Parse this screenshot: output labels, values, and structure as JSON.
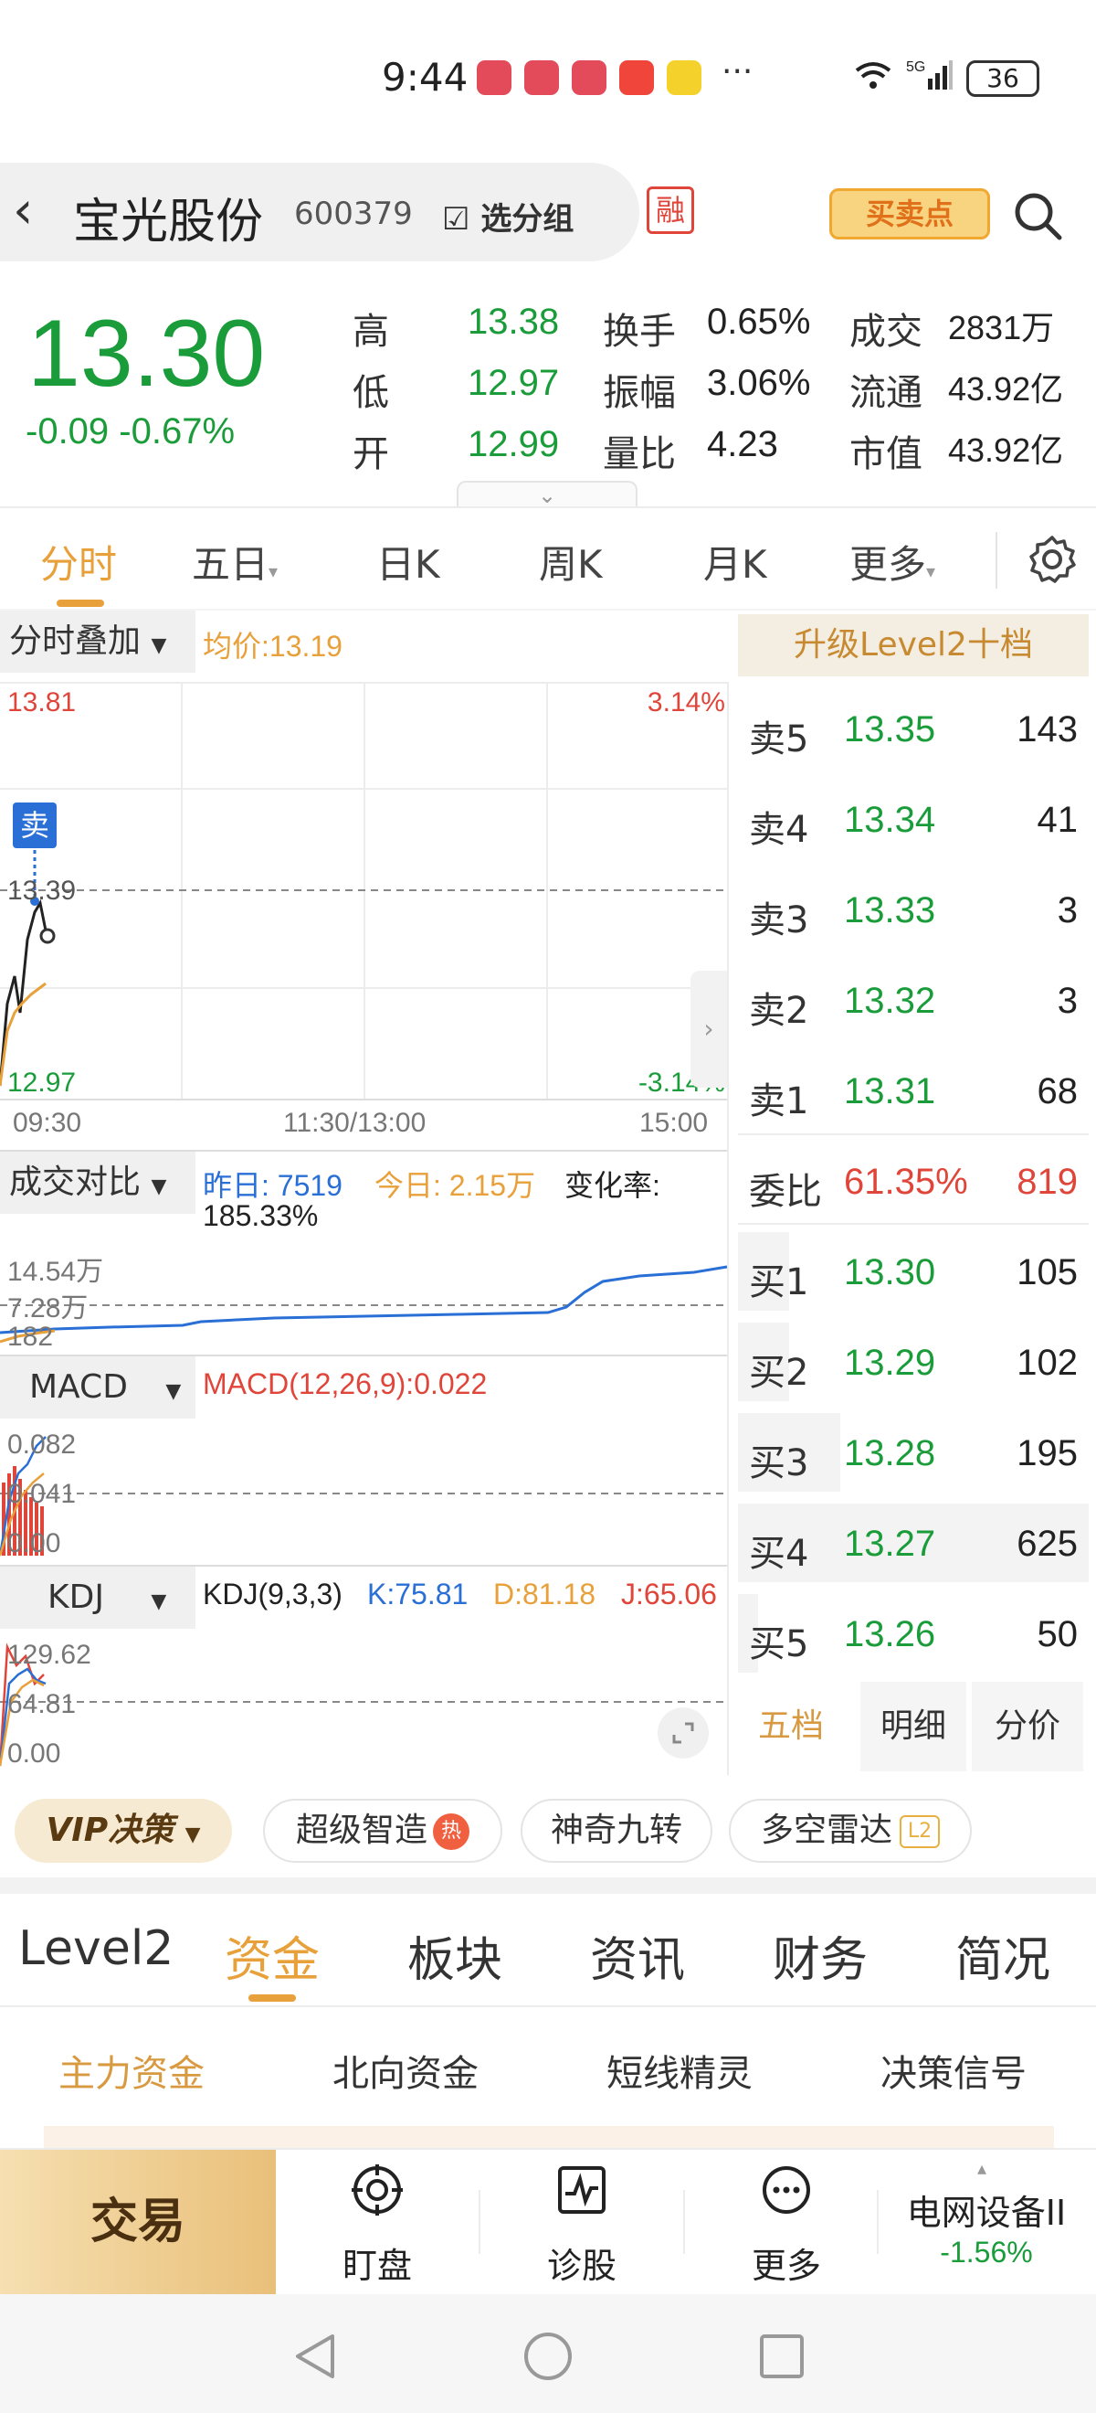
{
  "status_bar": {
    "time": "9:44",
    "dots": "···",
    "network": "5G",
    "wifi_num": "6",
    "battery": "36"
  },
  "header": {
    "name": "宝光股份",
    "code": "600379",
    "group_label": "选分组",
    "rong_label": "融",
    "buy_sell_label": "买卖点"
  },
  "quote": {
    "price": "13.30",
    "change": "-0.09",
    "change_pct": "-0.67%",
    "rows": [
      {
        "l1": "高",
        "v1": "13.38",
        "l2": "换手",
        "v2": "0.65%",
        "l3": "成交",
        "v3": "2831万"
      },
      {
        "l1": "低",
        "v1": "12.97",
        "l2": "振幅",
        "v2": "3.06%",
        "l3": "流通",
        "v3": "43.92亿"
      },
      {
        "l1": "开",
        "v1": "12.99",
        "l2": "量比",
        "v2": "4.23",
        "l3": "市值",
        "v3": "43.92亿"
      }
    ]
  },
  "time_tabs": [
    "分时",
    "五日",
    "日K",
    "周K",
    "月K",
    "更多"
  ],
  "chart": {
    "overlay_label": "分时叠加",
    "avg_price": "均价:13.19",
    "y_top": "13.81",
    "y_mark": "13.39",
    "y_bottom": "12.97",
    "pct_top": "3.14%",
    "pct_bottom": "-3.14%",
    "sell_tag": "卖",
    "x_labels": [
      "09:30",
      "11:30/13:00",
      "15:00"
    ],
    "volume": {
      "label": "成交对比",
      "yesterday": "昨日: 7519",
      "today": "今日: 2.15万",
      "change_rate_label": "变化率:",
      "change_rate": "185.33%",
      "y1": "14.54万",
      "y2": "7.28万",
      "y3": "182"
    },
    "macd": {
      "label": "MACD",
      "value": "MACD(12,26,9):0.022",
      "y1": "0.082",
      "y2": "0.041",
      "y3": "0.00"
    },
    "kdj": {
      "label": "KDJ",
      "params": "KDJ(9,3,3)",
      "k": "K:75.81",
      "d": "D:81.18",
      "j": "J:65.06",
      "y1": "129.62",
      "y2": "64.81",
      "y3": "0.00"
    }
  },
  "order_book": {
    "title": "升级Level2十档",
    "asks": [
      {
        "label": "卖5",
        "price": "13.35",
        "vol": "143"
      },
      {
        "label": "卖4",
        "price": "13.34",
        "vol": "41"
      },
      {
        "label": "卖3",
        "price": "13.33",
        "vol": "3"
      },
      {
        "label": "卖2",
        "price": "13.32",
        "vol": "3"
      },
      {
        "label": "卖1",
        "price": "13.31",
        "vol": "68"
      }
    ],
    "ratio": {
      "label": "委比",
      "pct": "61.35%",
      "vol": "819"
    },
    "bids": [
      {
        "label": "买1",
        "price": "13.30",
        "vol": "105"
      },
      {
        "label": "买2",
        "price": "13.29",
        "vol": "102"
      },
      {
        "label": "买3",
        "price": "13.28",
        "vol": "195"
      },
      {
        "label": "买4",
        "price": "13.27",
        "vol": "625"
      },
      {
        "label": "买5",
        "price": "13.26",
        "vol": "50"
      }
    ],
    "tabs": [
      "五档",
      "明细",
      "分价"
    ]
  },
  "vip_bar": {
    "vip": "VIP决策",
    "chip1": "超级智造",
    "chip1_badge": "热",
    "chip2": "神奇九转",
    "chip3": "多空雷达",
    "chip3_badge": "L2"
  },
  "bottom_tabs": [
    "Level2",
    "资金",
    "板块",
    "资讯",
    "财务",
    "简况"
  ],
  "sub_tabs": [
    "主力资金",
    "北向资金",
    "短线精灵",
    "决策信号"
  ],
  "toolbar": {
    "trade": "交易",
    "items": [
      "盯盘",
      "诊股",
      "更多"
    ],
    "industry_name": "电网设备II",
    "industry_change": "-1.56%"
  },
  "colors": {
    "down": "#1a9c3a",
    "up": "#e0453a",
    "accent": "#e8a03a"
  }
}
